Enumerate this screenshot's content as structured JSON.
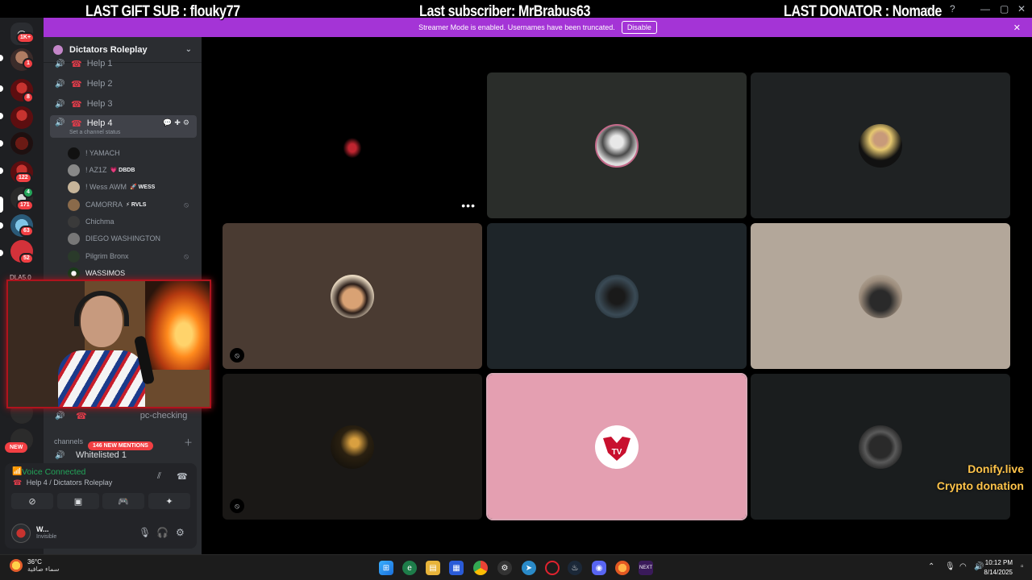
{
  "overlay": {
    "last_gift_sub": "LAST GIFT SUB : flouky77",
    "last_subscriber": "Last subscriber: MrBrabus63",
    "last_donator": "LAST DONATOR : Nomade",
    "donify": "Donify.live",
    "crypto": "Crypto donation"
  },
  "streamer_bar": {
    "message": "Streamer Mode is enabled. Usernames have been truncated.",
    "disable_label": "Disable"
  },
  "rail": {
    "home_badge": "1K+",
    "badges": [
      "1",
      "8",
      "122",
      "4",
      "171",
      "63",
      "52"
    ],
    "label": "DLA5.0",
    "new_label": "NEW"
  },
  "sidebar": {
    "server_name": "Dictators Roleplay",
    "channels": [
      {
        "name": "Help 1"
      },
      {
        "name": "Help 2"
      },
      {
        "name": "Help 3"
      },
      {
        "name": "Help 4",
        "status": "Set a channel status"
      }
    ],
    "members": [
      {
        "name": "! YAMACH",
        "tag": ""
      },
      {
        "name": "! AZ1Z",
        "tag": "💗 DBDB"
      },
      {
        "name": "! Wess AWM",
        "tag": "🚀 WESS"
      },
      {
        "name": "CAMORRA",
        "tag": "⚡ RVLS"
      },
      {
        "name": "Chichma",
        "tag": ""
      },
      {
        "name": "DIEGO WASHINGTON",
        "tag": ""
      },
      {
        "name": "Pilgrim Bronx",
        "tag": ""
      },
      {
        "name": "WASSIMOS",
        "tag": ""
      }
    ],
    "pc_checking": "pc-checking",
    "channels_label": "channels",
    "mentions": "146 NEW MENTIONS",
    "whitelisted": "Whitelisted 1"
  },
  "voice": {
    "connected": "Voice Connected",
    "location": "Help 4 / Dictators Roleplay"
  },
  "user": {
    "name": "W...",
    "status": "Invisible"
  },
  "taskbar": {
    "temp": "36°C",
    "weather": "سماء صافية",
    "time": "10:12 PM",
    "date": "8/14/2025"
  },
  "colors": {
    "streamer_bar": "#a434d6",
    "voice_green": "#23a559",
    "mention_red": "#f23f43"
  }
}
